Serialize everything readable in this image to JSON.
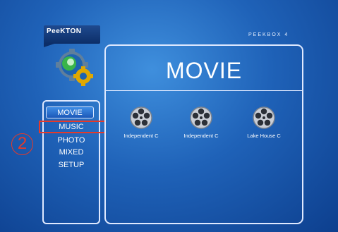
{
  "brand": {
    "logo_text": "PeeKTON",
    "model_text": "PEEKBOX 4"
  },
  "menu": {
    "items": [
      "MOVIE",
      "MUSIC",
      "PHOTO",
      "MIXED",
      "SETUP"
    ],
    "selected": "MOVIE",
    "highlighted": "MUSIC"
  },
  "annotation": {
    "step_number": "2",
    "color": "#e53a2a"
  },
  "main": {
    "title": "MOVIE",
    "files": [
      {
        "label": "Independent C",
        "icon": "film-reel-icon"
      },
      {
        "label": "Independent C",
        "icon": "film-reel-icon"
      },
      {
        "label": "Lake House C",
        "icon": "film-reel-icon"
      }
    ]
  },
  "colors": {
    "background": "#1f62b8",
    "border": "#dfe9ff",
    "selected_bg": "#2f77d8"
  }
}
